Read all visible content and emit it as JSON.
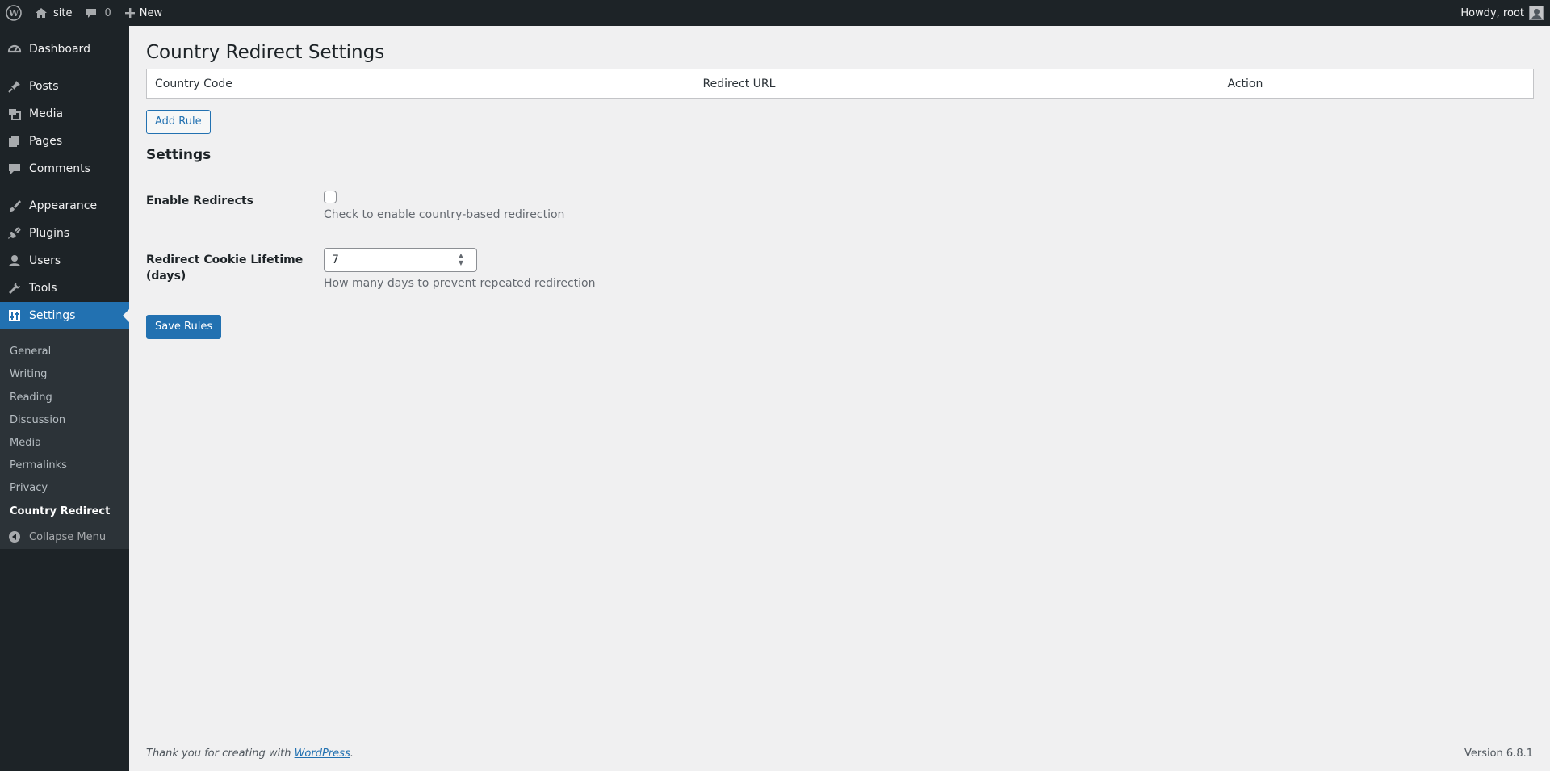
{
  "adminbar": {
    "site_name": "site",
    "comments_count": "0",
    "new_label": "New",
    "greeting": "Howdy, root"
  },
  "sidebar": {
    "items": [
      {
        "label": "Dashboard",
        "icon": "dashboard-icon"
      },
      {
        "label": "Posts",
        "icon": "pin-icon"
      },
      {
        "label": "Media",
        "icon": "media-icon"
      },
      {
        "label": "Pages",
        "icon": "pages-icon"
      },
      {
        "label": "Comments",
        "icon": "comment-icon"
      },
      {
        "label": "Appearance",
        "icon": "brush-icon"
      },
      {
        "label": "Plugins",
        "icon": "plug-icon"
      },
      {
        "label": "Users",
        "icon": "user-icon"
      },
      {
        "label": "Tools",
        "icon": "wrench-icon"
      },
      {
        "label": "Settings",
        "icon": "settings-icon"
      }
    ],
    "submenu": [
      "General",
      "Writing",
      "Reading",
      "Discussion",
      "Media",
      "Permalinks",
      "Privacy",
      "Country Redirect"
    ],
    "collapse_label": "Collapse Menu"
  },
  "main": {
    "title": "Country Redirect Settings",
    "table_headers": [
      "Country Code",
      "Redirect URL",
      "Action"
    ],
    "add_rule_label": "Add Rule",
    "settings_title": "Settings",
    "enable_label": "Enable Redirects",
    "enable_checked": false,
    "enable_desc": "Check to enable country-based redirection",
    "lifetime_label": "Redirect Cookie Lifetime (days)",
    "lifetime_value": "7",
    "lifetime_desc": "How many days to prevent repeated redirection",
    "save_label": "Save Rules"
  },
  "footer": {
    "thanks_prefix": "Thank you for creating with ",
    "wordpress_link": "WordPress",
    "thanks_suffix": ".",
    "version": "Version 6.8.1"
  },
  "colors": {
    "accent": "#2271b1",
    "sidebar_bg": "#1d2327",
    "submenu_bg": "#2c3338",
    "page_bg": "#f0f0f1"
  }
}
